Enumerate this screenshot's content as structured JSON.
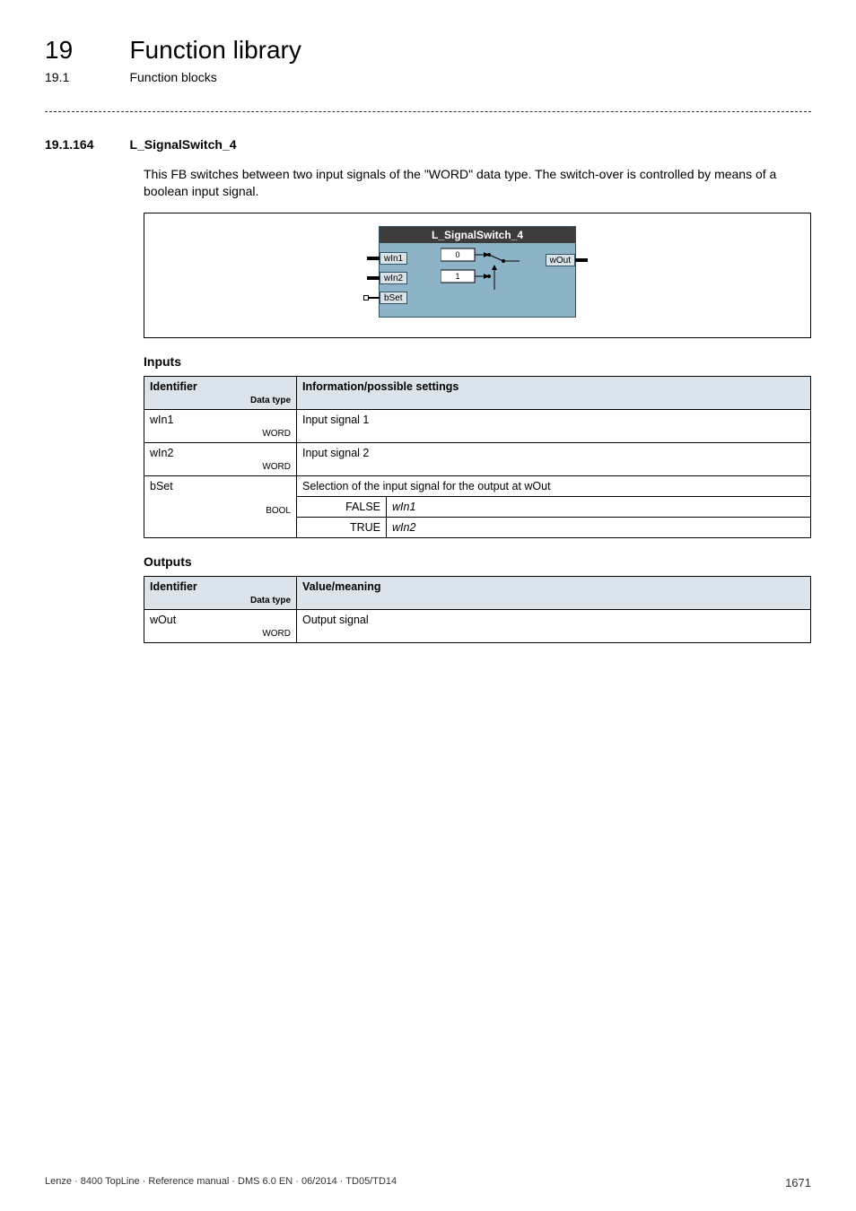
{
  "chapter": {
    "num": "19",
    "title": "Function library"
  },
  "section": {
    "num": "19.1",
    "title": "Function blocks"
  },
  "subsection": {
    "num": "19.1.164",
    "title": "L_SignalSwitch_4"
  },
  "intro": "This FB switches between two input signals of the \"WORD\" data type. The switch-over is controlled by means of a boolean input signal.",
  "block": {
    "title": "L_SignalSwitch_4",
    "in": [
      "wIn1",
      "wIn2",
      "bSet"
    ],
    "out": [
      "wOut"
    ],
    "sw_labels": [
      "0",
      "1"
    ]
  },
  "inputs": {
    "heading": "Inputs",
    "headers": {
      "id": "Identifier",
      "dt": "Data type",
      "info": "Information/possible settings"
    },
    "rows": [
      {
        "name": "wIn1",
        "type": "WORD",
        "info": "Input signal 1"
      },
      {
        "name": "wIn2",
        "type": "WORD",
        "info": "Input signal 2"
      },
      {
        "name": "bSet",
        "type": "BOOL",
        "info": "Selection of the input signal for the output at wOut",
        "sub": [
          {
            "k": "FALSE",
            "v": "wIn1"
          },
          {
            "k": "TRUE",
            "v": "wIn2"
          }
        ]
      }
    ]
  },
  "outputs": {
    "heading": "Outputs",
    "headers": {
      "id": "Identifier",
      "dt": "Data type",
      "info": "Value/meaning"
    },
    "rows": [
      {
        "name": "wOut",
        "type": "WORD",
        "info": "Output signal"
      }
    ]
  },
  "footer": {
    "left": "Lenze · 8400 TopLine · Reference manual · DMS 6.0 EN · 06/2014 · TD05/TD14",
    "page": "1671"
  }
}
